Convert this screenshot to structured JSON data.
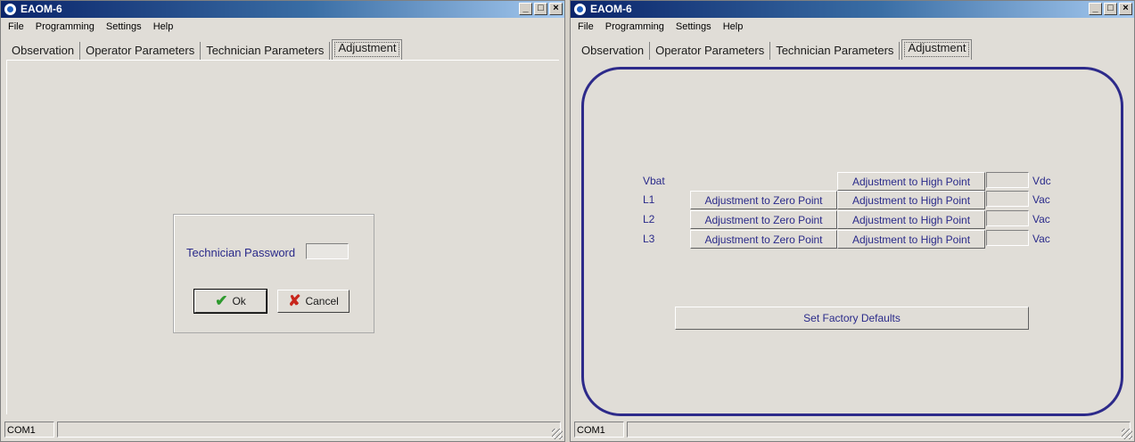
{
  "windows": [
    {
      "title": "EAOM-6",
      "menu": [
        "File",
        "Programming",
        "Settings",
        "Help"
      ],
      "tabs": [
        "Observation",
        "Operator Parameters",
        "Technician Parameters",
        "Adjustment"
      ],
      "active_tab": "Adjustment",
      "login": {
        "label": "Technician Password",
        "password_value": "",
        "ok_label": "Ok",
        "cancel_label": "Cancel"
      },
      "status": {
        "port": "COM1",
        "message": ""
      }
    },
    {
      "title": "EAOM-6",
      "menu": [
        "File",
        "Programming",
        "Settings",
        "Help"
      ],
      "tabs": [
        "Observation",
        "Operator Parameters",
        "Technician Parameters",
        "Adjustment"
      ],
      "active_tab": "Adjustment",
      "adjustment": {
        "rows": [
          {
            "label": "Vbat",
            "zero_label": null,
            "high_label": "Adjustment to High Point",
            "value": "",
            "unit": "Vdc"
          },
          {
            "label": "L1",
            "zero_label": "Adjustment to Zero Point",
            "high_label": "Adjustment to High Point",
            "value": "",
            "unit": "Vac"
          },
          {
            "label": "L2",
            "zero_label": "Adjustment to Zero Point",
            "high_label": "Adjustment to High Point",
            "value": "",
            "unit": "Vac"
          },
          {
            "label": "L3",
            "zero_label": "Adjustment to Zero Point",
            "high_label": "Adjustment to High Point",
            "value": "",
            "unit": "Vac"
          }
        ],
        "factory_label": "Set Factory Defaults"
      },
      "status": {
        "port": "COM1",
        "message": ""
      }
    }
  ],
  "colors": {
    "title_bar": "#0a246a",
    "label_text": "#2a2a8a",
    "frame_border": "#2d2a8a",
    "window_bg": "#e0ddd7"
  },
  "icons": {
    "app": "app-logo-icon",
    "ok": "check-icon",
    "cancel": "x-icon"
  }
}
